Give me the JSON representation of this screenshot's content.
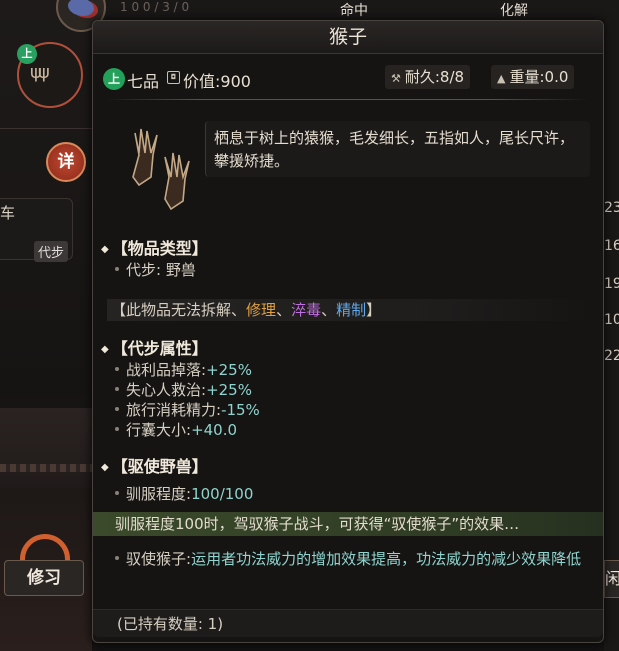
{
  "background": {
    "top_stat_left": "命中",
    "top_stat_right": "化解",
    "top_stat_faded": "1 0 0   / 3 / 0",
    "grade_small": "上",
    "detail_button": "详",
    "car_label": "车",
    "daibu_tag": "代步",
    "repair_button": "修习",
    "right_numbers": [
      "23",
      "16",
      "19",
      "10",
      "22"
    ],
    "right_button": "闲"
  },
  "tooltip": {
    "title": "猴子",
    "grade_badge": "上",
    "grade_label": "七品",
    "value_label": "价值:900",
    "durability": "耐久:8/8",
    "weight": "重量:0.0",
    "description": "栖息于树上的猿猴，毛发细长，五指如人，尾长尺许，攀援矫捷。",
    "item_type": {
      "header": "【物品类型】",
      "line": "代步: 野兽"
    },
    "restriction": {
      "prefix": "【此物品无法",
      "break": "拆解",
      "sep1": "、",
      "repair": "修理",
      "sep2": "、",
      "poison": "淬毒",
      "sep3": "、",
      "refine": "精制",
      "suffix": "】"
    },
    "mount_attrs": {
      "header": "【代步属性】",
      "items": [
        {
          "label": "战利品掉落:",
          "value": "+25%"
        },
        {
          "label": "失心人救治:",
          "value": "+25%"
        },
        {
          "label": "旅行消耗精力:",
          "value": "-15%"
        },
        {
          "label": "行囊大小:",
          "value": "+40.0"
        }
      ]
    },
    "beast": {
      "header": "【驱使野兽】",
      "tame_label": "驯服程度:",
      "tame_value": "100/100",
      "tame_note": "驯服程度100时，驾驭猴子战斗，可获得“驭使猴子”的效果…",
      "effect_label": "驭使猴子:",
      "effect_text": "运用者功法威力的增加效果提高，功法威力的减少效果降低"
    },
    "owned": "(已持有数量: 1)"
  },
  "colors": {
    "grade_green": "#23a05a",
    "positive": "#8fd4ce",
    "repair": "#e0a040",
    "poison": "#c070e0",
    "refine": "#60a8e8",
    "tame_bar": "#3a4a2a"
  }
}
